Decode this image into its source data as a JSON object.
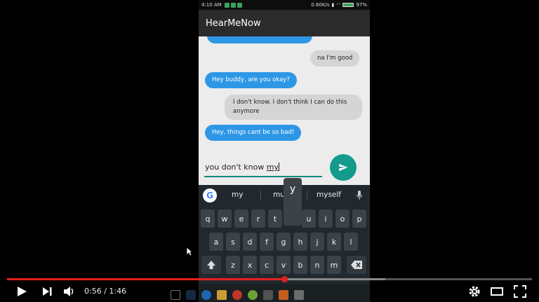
{
  "status_bar": {
    "time": "4:10 AM",
    "net_speed": "0.60K/s",
    "battery": "97%",
    "battery_level": 0.97
  },
  "app": {
    "title": "HearMeNow"
  },
  "messages": [
    {
      "from": "out",
      "text": "na I'm good"
    },
    {
      "from": "in",
      "text": "Hey buddy, are you okay?"
    },
    {
      "from": "out",
      "text": "I don't know. I don't think I can do this anymore"
    },
    {
      "from": "in",
      "text": "Hey, things cant be so bad!"
    }
  ],
  "composer": {
    "text_before": "you don't know ",
    "text_underlined": "my",
    "send_icon": "send-icon"
  },
  "keyboard": {
    "suggestions": [
      "my",
      "mu...",
      "myself"
    ],
    "popup_key": "y",
    "row1": [
      "q",
      "w",
      "e",
      "r",
      "t",
      "y",
      "u",
      "i",
      "o",
      "p"
    ],
    "row2": [
      "a",
      "s",
      "d",
      "f",
      "g",
      "h",
      "j",
      "k",
      "l"
    ],
    "row3": [
      "z",
      "x",
      "c",
      "v",
      "b",
      "n",
      "m"
    ]
  },
  "player": {
    "time": "0:56 / 1:46",
    "played_fraction": 0.528,
    "loaded_fraction": 0.72
  },
  "colors": {
    "accent_blue": "#2d97e6",
    "fab": "#139b8c",
    "progress": "#e4201e"
  }
}
